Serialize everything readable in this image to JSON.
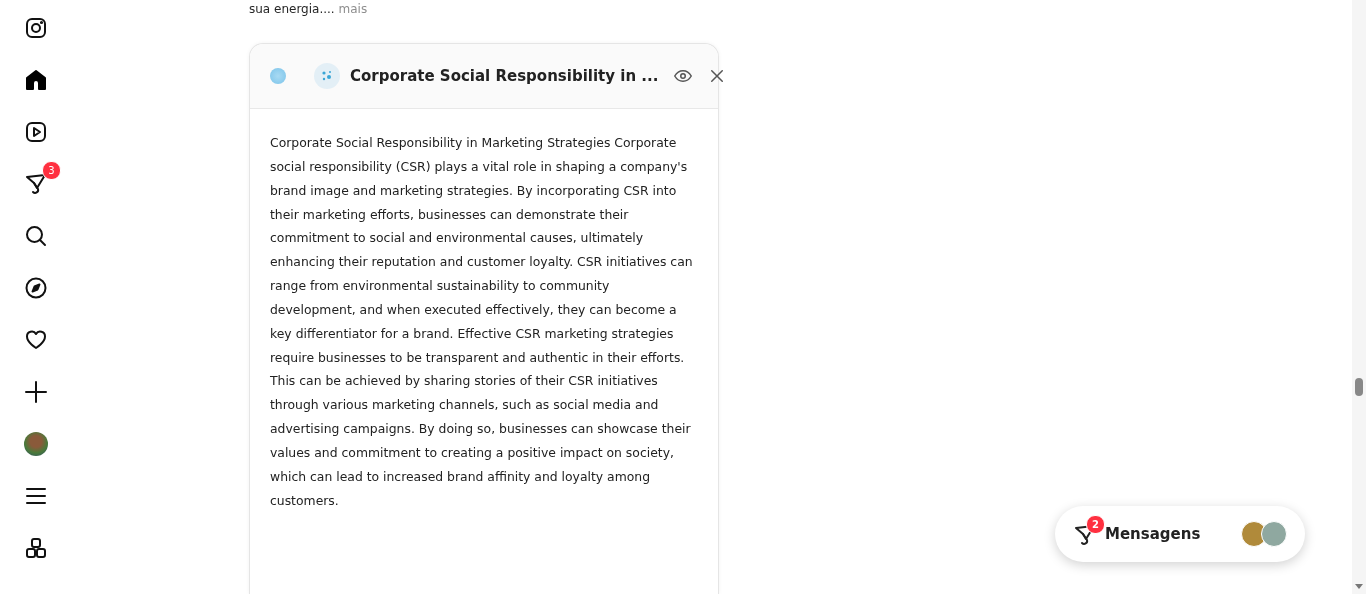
{
  "sidebar": {
    "items": [
      {
        "kind": "logo",
        "selected": false
      },
      {
        "kind": "home",
        "selected": true
      },
      {
        "kind": "reels",
        "selected": false
      },
      {
        "kind": "messages",
        "selected": false,
        "badge": "3"
      },
      {
        "kind": "search",
        "selected": false
      },
      {
        "kind": "explore",
        "selected": false
      },
      {
        "kind": "heart",
        "selected": false
      },
      {
        "kind": "plus",
        "selected": false
      },
      {
        "kind": "avatar",
        "selected": false
      },
      {
        "kind": "menu",
        "selected": false
      },
      {
        "kind": "apps",
        "selected": false
      }
    ]
  },
  "previous_post": {
    "text": "sua energia....",
    "more_link": "mais"
  },
  "summary_card": {
    "title": "Corporate Social Responsibility in ...",
    "body": "Corporate Social Responsibility in Marketing Strategies Corporate social responsibility (CSR) plays a vital role in shaping a company's brand image and marketing strategies. By incorporating CSR into their marketing efforts, businesses can demonstrate their commitment to social and environmental causes, ultimately enhancing their reputation and customer loyalty. CSR initiatives can range from environmental sustainability to community development, and when executed effectively, they can become a key differentiator for a brand. Effective CSR marketing strategies require businesses to be transparent and authentic in their efforts. This can be achieved by sharing stories of their CSR initiatives through various marketing channels, such as social media and advertising campaigns. By doing so, businesses can showcase their values and commitment to creating a positive impact on society, which can lead to increased brand affinity and loyalty among customers."
  },
  "messages_button": {
    "label": "Mensagens",
    "badge": "2"
  }
}
